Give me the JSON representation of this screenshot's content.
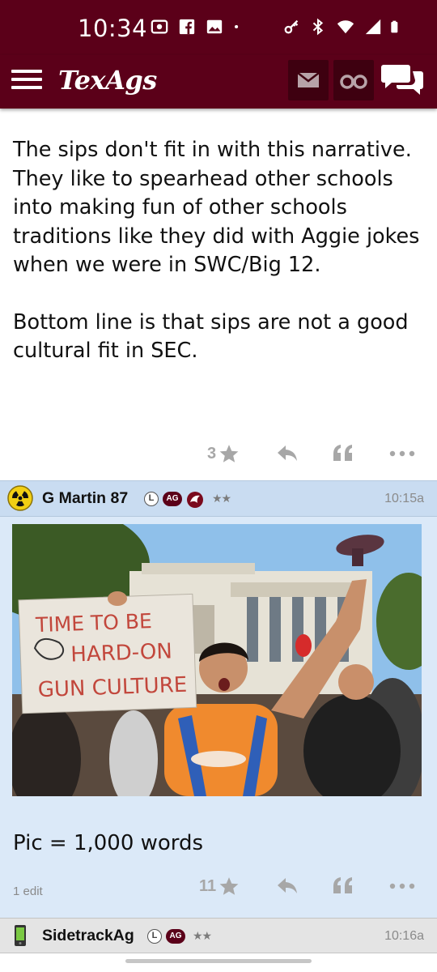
{
  "status_bar": {
    "time": "10:34",
    "left_icons": [
      "screen-record-icon",
      "facebook-icon",
      "image-icon",
      "dot-icon"
    ],
    "right_icons": [
      "key-icon",
      "bluetooth-icon",
      "wifi-icon",
      "signal-icon",
      "battery-icon"
    ]
  },
  "app_bar": {
    "logo": "TexAgs",
    "buttons": [
      "hamburger-menu-icon",
      "mail-icon",
      "binoculars-icon",
      "chat-bubbles-icon"
    ]
  },
  "colors": {
    "brand_maroon": "#5b0019",
    "post_bg_highlight": "#dbe9f8",
    "post_header_highlight": "#c9dcf1",
    "action_gray": "#a7a7a7"
  },
  "post1": {
    "paragraph1": "The sips don't fit in with this narrative. They like to spearhead other schools into making fun of other schools traditions like they did with Aggie jokes when we were in SWC/Big 12.",
    "paragraph2": "Bottom line is that sips are not a good cultural fit in SEC.",
    "star_count": "3"
  },
  "post2": {
    "username": "G Martin 87",
    "badge_l": "L",
    "badge_ag": "AG",
    "rank_stars": "★★",
    "time": "10:15a",
    "image_sign": {
      "line1": "TIME TO BE",
      "line2": "HARD-ON",
      "line3": "GUN CULTURE"
    },
    "caption": "Pic = 1,000 words",
    "edits": "1 edit",
    "star_count": "11"
  },
  "post3": {
    "username": "SidetrackAg",
    "badge_l": "L",
    "badge_ag": "AG",
    "rank_stars": "★★",
    "time": "10:16a"
  }
}
